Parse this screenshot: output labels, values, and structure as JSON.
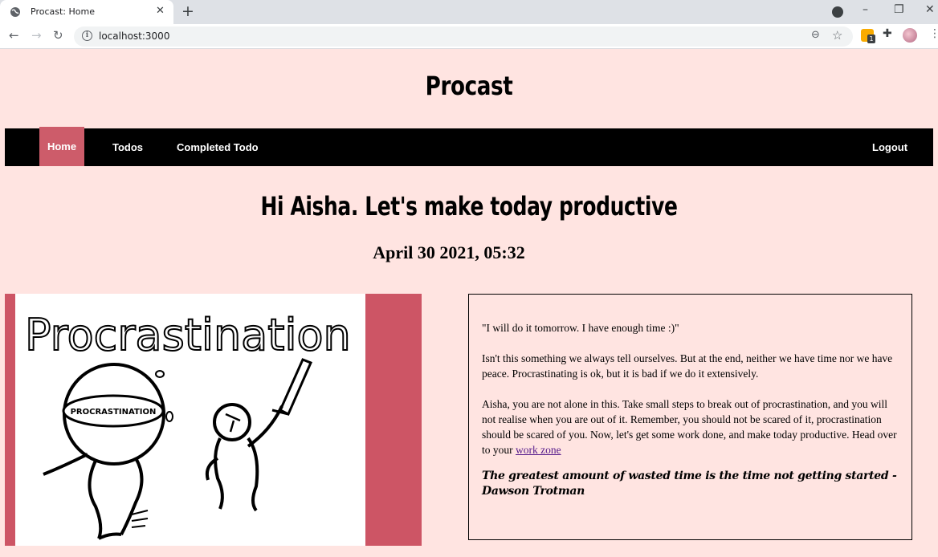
{
  "browser": {
    "tab_title": "Procast: Home",
    "tab_close": "✕",
    "new_tab": "+",
    "url": "localhost:3000",
    "extension_badge_count": "1",
    "window_controls": {
      "minimize": "–",
      "restore": "❐",
      "close": "✕"
    }
  },
  "site": {
    "title": "Procast"
  },
  "nav": {
    "home": "Home",
    "todos": "Todos",
    "completed": "Completed Todo",
    "logout": "Logout",
    "active_color": "#cd5c6a"
  },
  "main": {
    "greeting": "Hi Aisha. Let's make today productive",
    "datetime": "April 30 2021, 05:32"
  },
  "illustration": {
    "heading": "Procrastination",
    "ball_label": "PROCRASTINATION",
    "panel_color": "#cd5565"
  },
  "quote": {
    "line1": "\"I will do it tomorrow. I have enough time :)\"",
    "para2": "Isn't this something we always tell ourselves. But at the end, neither we have time nor we have peace. Procrastinating is ok, but it is bad if we do it extensively.",
    "para3": "Aisha, you are not alone in this. Take small steps to break out of procrastination, and you will not realise when you are out of it. Remember, you should not be scared of it, procrastination should be scared of you. Now, let's get some work done, and make today productive. Head over to your",
    "link": "work zone",
    "citation": "The greatest amount of wasted time is the time not getting started - Dawson Trotman"
  }
}
